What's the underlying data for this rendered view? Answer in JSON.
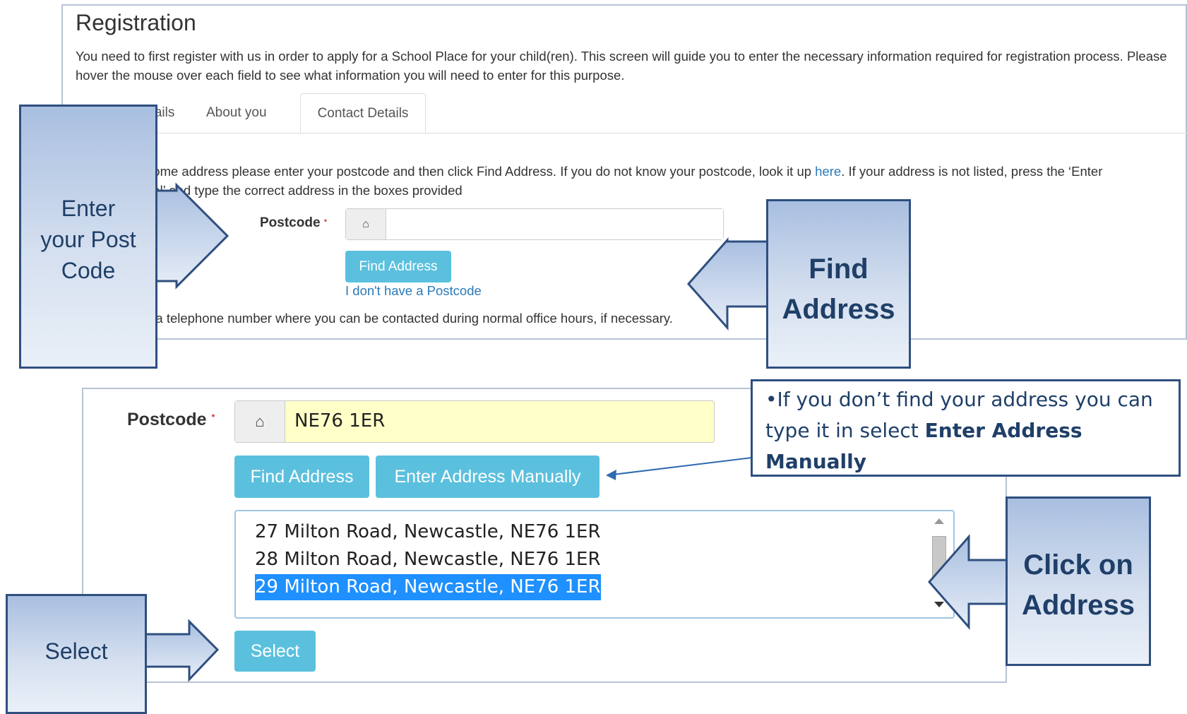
{
  "registration": {
    "title": "Registration",
    "intro": "You need to first register with us in order to apply for a School Place for your child(ren). This screen will guide you to enter the necessary information required for registration process. Please hover the mouse over each field to see what information you will need to enter for this purpose.",
    "tabs": [
      {
        "label": "etails"
      },
      {
        "label": "About you"
      },
      {
        "label": "Contact Details"
      }
    ],
    "address_help_before": "home address please enter your postcode and then click Find Address. If you do not know your postcode, look it up ",
    "address_help_link": "here",
    "address_help_after": ". If your address is not listed, press the ‘Enter",
    "address_help_line2": "ual’ and type the correct address in the boxes provided",
    "postcode_label": "Postcode",
    "required_mark": "•",
    "postcode_value": "",
    "find_address_label": "Find Address",
    "no_postcode_link": "I don't have a Postcode",
    "telephone_text": "y a telephone number where you can be contacted during normal office hours, if necessary."
  },
  "address_step": {
    "postcode_label": "Postcode",
    "postcode_value": "NE76 1ER",
    "find_address_label": "Find Address",
    "manual_label": "Enter Address Manually",
    "addresses": [
      "27 Milton Road, Newcastle, NE76 1ER",
      "28 Milton Road, Newcastle, NE76 1ER",
      "29 Milton Road, Newcastle, NE76 1ER"
    ],
    "selected_index": 2,
    "select_label": "Select"
  },
  "callouts": {
    "postcode": [
      "Enter",
      "your Post",
      "Code"
    ],
    "find": [
      "Find",
      "Address"
    ],
    "click": [
      "Click on",
      "Address"
    ],
    "select": "Select",
    "note_prefix": "•If you don’t find your address you can type it in select ",
    "note_bold": "Enter Address Manually"
  },
  "icons": {
    "postcode_addon": "home-icon"
  },
  "colors": {
    "button": "#5bc0de",
    "link": "#2a7ab8",
    "selected_row": "#1e90ff",
    "callout_border": "#2f4f7f",
    "postcode_fill": "#ffffc8"
  }
}
